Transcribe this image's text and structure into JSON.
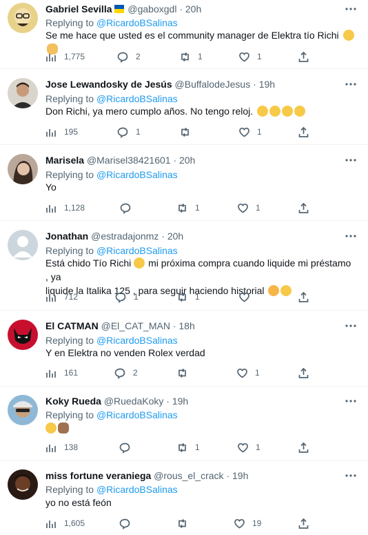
{
  "tweets": [
    {
      "name": "Gabriel Sevilla",
      "handle": "@gaboxgdl",
      "time": "20h",
      "reply_prefix": "Replying to",
      "reply_to": "@RicardoBSalinas",
      "text": "Se me hace que usted es el community manager de Elektra tío Richi",
      "emojis": [
        "face-with-tears-of-joy",
        "ok-hand"
      ],
      "views": "1,775",
      "replies": "2",
      "retweets": "1",
      "likes": "1"
    },
    {
      "name": "Jose Lewandosky de Jesús",
      "handle": "@BuffalodeJesus",
      "time": "19h",
      "reply_prefix": "Replying to",
      "reply_to": "@RicardoBSalinas",
      "text": "Don Richi, ya mero cumplo años. No tengo reloj.",
      "emojis": [
        "crying-face",
        "crying-face",
        "crying-face",
        "crying-face"
      ],
      "views": "195",
      "replies": "1",
      "retweets": "",
      "likes": "1"
    },
    {
      "name": "Marisela",
      "handle": "@Marisel38421601",
      "time": "20h",
      "reply_prefix": "Replying to",
      "reply_to": "@RicardoBSalinas",
      "text": "Yo",
      "emojis": [],
      "views": "1,128",
      "replies": "",
      "retweets": "1",
      "likes": "1"
    },
    {
      "name": "Jonathan",
      "handle": "@estradajonmz",
      "time": "20h",
      "reply_prefix": "Replying to",
      "reply_to": "@RicardoBSalinas",
      "text_line1": "Está chido Tío Richi",
      "text_line1b": " mi próxima compra cuando liquide mi préstamo , ya",
      "text_line2": "liquide la Italika 125 , para seguir haciendo historial",
      "emojis": [
        "sunglasses-face",
        "hugging-face",
        "smiling-face"
      ],
      "views": "712",
      "replies": "1",
      "retweets": "1",
      "likes": ""
    },
    {
      "name": "El CATMAN",
      "handle": "@El_CAT_MAN",
      "time": "18h",
      "reply_prefix": "Replying to",
      "reply_to": "@RicardoBSalinas",
      "text": "Y en Elektra no venden Rolex verdad",
      "emojis": [],
      "views": "161",
      "replies": "2",
      "retweets": "",
      "likes": "1"
    },
    {
      "name": "Koky Rueda",
      "handle": "@RuedaKoky",
      "time": "19h",
      "reply_prefix": "Replying to",
      "reply_to": "@RicardoBSalinas",
      "text": "",
      "emojis": [
        "rolling-laughing-face",
        "thumbs-up"
      ],
      "views": "138",
      "replies": "",
      "retweets": "1",
      "likes": "1"
    },
    {
      "name": "miss fortune veraniega",
      "handle": "@rous_el_crack",
      "time": "19h",
      "reply_prefix": "Replying to",
      "reply_to": "@RicardoBSalinas",
      "text": "yo no está feón",
      "emojis": [],
      "views": "1,605",
      "replies": "",
      "retweets": "",
      "likes": "19"
    }
  ],
  "separator": "·",
  "colors": {
    "accent": "#1d9bf0",
    "secondary_text": "#536471",
    "primary_text": "#0f1419",
    "divider": "#eff3f4"
  }
}
